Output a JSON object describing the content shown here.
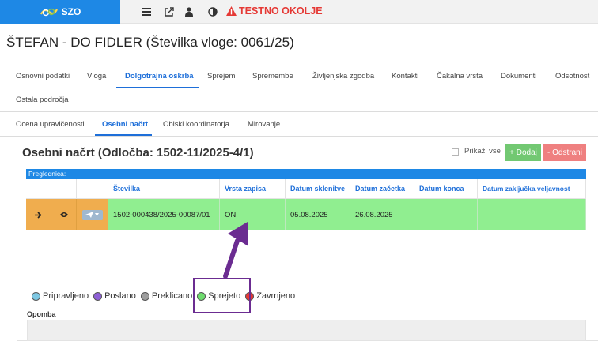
{
  "topbar": {
    "brand": "SZO",
    "env_warning": "TESTNO OKOLJE",
    "icons": [
      "list-icon",
      "external-link-icon",
      "user-icon",
      "contrast-icon"
    ]
  },
  "page_title": "ŠTEFAN - DO FIDLER (Številka vloge: 0061/25)",
  "tabs": [
    {
      "label": "Osnovni podatki"
    },
    {
      "label": "Vloga"
    },
    {
      "label": "Dolgotrajna oskrba",
      "active": true
    },
    {
      "label": "Sprejem"
    },
    {
      "label": "Spremembe"
    },
    {
      "label": "Življenjska zgodba"
    },
    {
      "label": "Kontakti"
    },
    {
      "label": "Čakalna vrsta"
    },
    {
      "label": "Dokumenti"
    },
    {
      "label": "Odsotnost"
    },
    {
      "label": "Ostala področja"
    }
  ],
  "subtabs": [
    {
      "label": "Ocena upravičenosti"
    },
    {
      "label": "Osebni načrt",
      "active": true
    },
    {
      "label": "Obiski koordinatorja"
    },
    {
      "label": "Mirovanje"
    }
  ],
  "panel": {
    "title": "Osebni načrt (Odločba: 1502-11/2025-4/1)",
    "show_all_label": "Prikaži vse",
    "add_label": "+ Dodaj",
    "remove_label": "- Odstrani"
  },
  "grid": {
    "caption": "Preglednica:",
    "columns": [
      "Številka",
      "Vrsta zapisa",
      "Datum sklenitve",
      "Datum začetka",
      "Datum konca",
      "Datum zaključka veljavnost"
    ],
    "row": {
      "stevilka": "1502-000438/2025-00087/01",
      "vrsta_zapisa": "ON",
      "datum_sklenitve": "05.08.2025",
      "datum_zacetka": "26.08.2025",
      "datum_konca": "",
      "datum_zakljucka": ""
    }
  },
  "legend": [
    {
      "label": "Pripravljeno",
      "color": "#7ec8e3"
    },
    {
      "label": "Poslano",
      "color": "#8e5fd6"
    },
    {
      "label": "Preklicano",
      "color": "#9e9e9e"
    },
    {
      "label": "Sprejeto",
      "color": "#6fdc6f"
    },
    {
      "label": "Zavrnjeno",
      "color": "#e53935"
    }
  ],
  "note_label": "Opomba",
  "annotation_color": "#6b2c91"
}
